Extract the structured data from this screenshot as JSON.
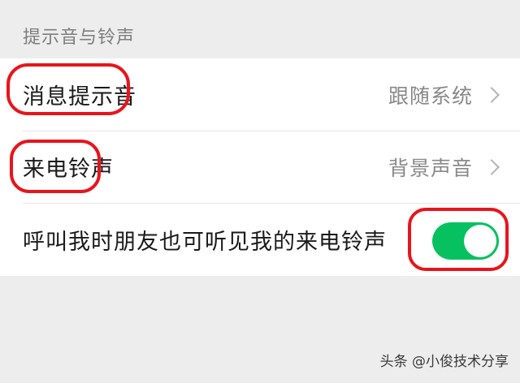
{
  "section": {
    "title": "提示音与铃声"
  },
  "settings": [
    {
      "label": "消息提示音",
      "value": "跟随系统"
    },
    {
      "label": "来电铃声",
      "value": "背景声音"
    },
    {
      "label": "呼叫我时朋友也可听见我的来电铃声",
      "toggle_on": true
    }
  ],
  "colors": {
    "toggle_on": "#07c160",
    "annotation": "#e8141c",
    "background": "#ededed"
  },
  "icons": {
    "chevron": "chevron-right-icon"
  },
  "watermark": "头条 @小俊技术分享"
}
